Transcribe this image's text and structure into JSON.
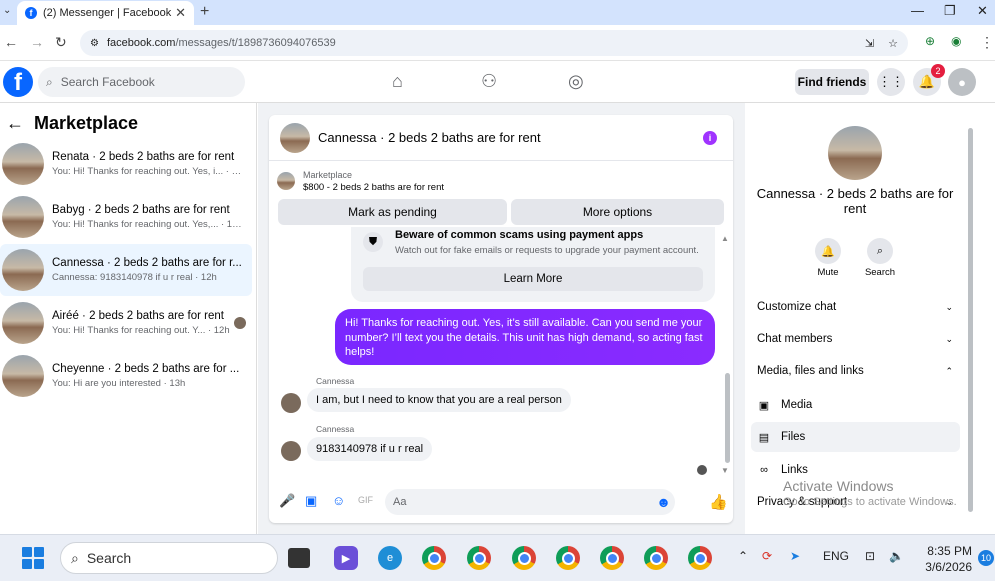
{
  "browser": {
    "tab_title": "(2) Messenger | Facebook",
    "url_host": "facebook.com",
    "url_path": "/messages/t/1898736094076539"
  },
  "fbnav": {
    "search_placeholder": "Search Facebook",
    "find_friends": "Find friends",
    "notification_count": "2"
  },
  "sidebar": {
    "title": "Marketplace",
    "conversations": [
      {
        "title": "Renata · 2 beds 2 baths are for rent",
        "preview": "You: Hi! Thanks for reaching out. Yes, i... · 9h",
        "selected": false
      },
      {
        "title": "Babyg · 2 beds 2 baths are for rent",
        "preview": "You: Hi! Thanks for reaching out. Yes,... · 12h",
        "selected": false
      },
      {
        "title": "Cannessa · 2 beds 2 baths are for r...",
        "preview": "Cannessa: 9183140978 if u r real · 12h",
        "selected": true
      },
      {
        "title": "Airéé · 2 beds 2 baths are for rent",
        "preview": "You: Hi! Thanks for reaching out. Y... · 12h",
        "selected": false
      },
      {
        "title": "Cheyenne · 2 beds 2 baths are for ...",
        "preview": "You: Hi are you interested · 13h",
        "selected": false
      }
    ]
  },
  "chat": {
    "title": "Cannessa · 2 beds 2 baths are for rent",
    "marketplace_label": "Marketplace",
    "listing": "$800 - 2 beds 2 baths are for rent",
    "mark_pending": "Mark as pending",
    "more_options": "More options",
    "scam_title": "Beware of common scams using payment apps",
    "scam_sub": "Watch out for fake emails or requests to upgrade your payment account.",
    "learn_more": "Learn More",
    "outgoing": "Hi! Thanks for reaching out. Yes, it’s still available. Can you send me your number? I’ll text you the details. This unit has high demand, so acting fast helps!",
    "sender1": "Cannessa",
    "incoming1": "I am, but I need to know that you are a real person",
    "sender2": "Cannessa",
    "incoming2": "9183140978 if u r real",
    "composer_placeholder": "Aa"
  },
  "right": {
    "name": "Cannessa · 2 beds 2 baths are for rent",
    "mute": "Mute",
    "search": "Search",
    "customize": "Customize chat",
    "members": "Chat members",
    "media_files_links": "Media, files and links",
    "media": "Media",
    "files": "Files",
    "links": "Links",
    "privacy": "Privacy & support"
  },
  "watermark": {
    "line1": "Activate Windows",
    "line2": "Go to Settings to activate Windows."
  },
  "taskbar": {
    "search": "Search",
    "lang": "ENG",
    "time": "8:35 PM",
    "date": "3/6/2026",
    "notif_count": "10"
  }
}
